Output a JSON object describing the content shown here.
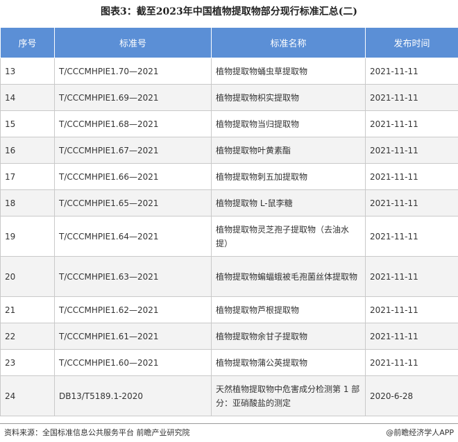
{
  "title": "图表3：截至2023年中国植物提取物部分现行标准汇总(二)",
  "table": {
    "headers": [
      "序号",
      "标准号",
      "标准名称",
      "发布时间"
    ],
    "rows": [
      {
        "num": "13",
        "code": "T/CCCMHPIE1.70—2021",
        "name": "植物提取物蛹虫草提取物",
        "date": "2021-11-11"
      },
      {
        "num": "14",
        "code": "T/CCCMHPIE1.69—2021",
        "name": "植物提取物枳实提取物",
        "date": "2021-11-11"
      },
      {
        "num": "15",
        "code": "T/CCCMHPIE1.68—2021",
        "name": "植物提取物当归提取物",
        "date": "2021-11-11"
      },
      {
        "num": "16",
        "code": "T/CCCMHPIE1.67—2021",
        "name": "植物提取物叶黄素酯",
        "date": "2021-11-11"
      },
      {
        "num": "17",
        "code": "T/CCCMHPIE1.66—2021",
        "name": "植物提取物刺五加提取物",
        "date": "2021-11-11"
      },
      {
        "num": "18",
        "code": "T/CCCMHPIE1.65—2021",
        "name": "植物提取物 L-鼠李糖",
        "date": "2021-11-11"
      },
      {
        "num": "19",
        "code": "T/CCCMHPIE1.64—2021",
        "name": "植物提取物灵芝孢子提取物（去油水提）",
        "date": "2021-11-11"
      },
      {
        "num": "20",
        "code": "T/CCCMHPIE1.63—2021",
        "name": "植物提取物蝙蝠蛾被毛孢菌丝体提取物",
        "date": "2021-11-11"
      },
      {
        "num": "21",
        "code": "T/CCCMHPIE1.62—2021",
        "name": "植物提取物芦根提取物",
        "date": "2021-11-11"
      },
      {
        "num": "22",
        "code": "T/CCCMHPIE1.61—2021",
        "name": "植物提取物余甘子提取物",
        "date": "2021-11-11"
      },
      {
        "num": "23",
        "code": "T/CCCMHPIE1.60—2021",
        "name": "植物提取物蒲公英提取物",
        "date": "2021-11-11"
      },
      {
        "num": "24",
        "code": "DB13/T5189.1-2020",
        "name": "天然植物提取物中危害成分检测第 1 部分：亚硝酸盐的测定",
        "date": "2020-6-28"
      }
    ]
  },
  "footer": {
    "source": "资料来源：全国标准信息公共服务平台 前瞻产业研究院",
    "brand": "@前瞻经济学人APP"
  }
}
